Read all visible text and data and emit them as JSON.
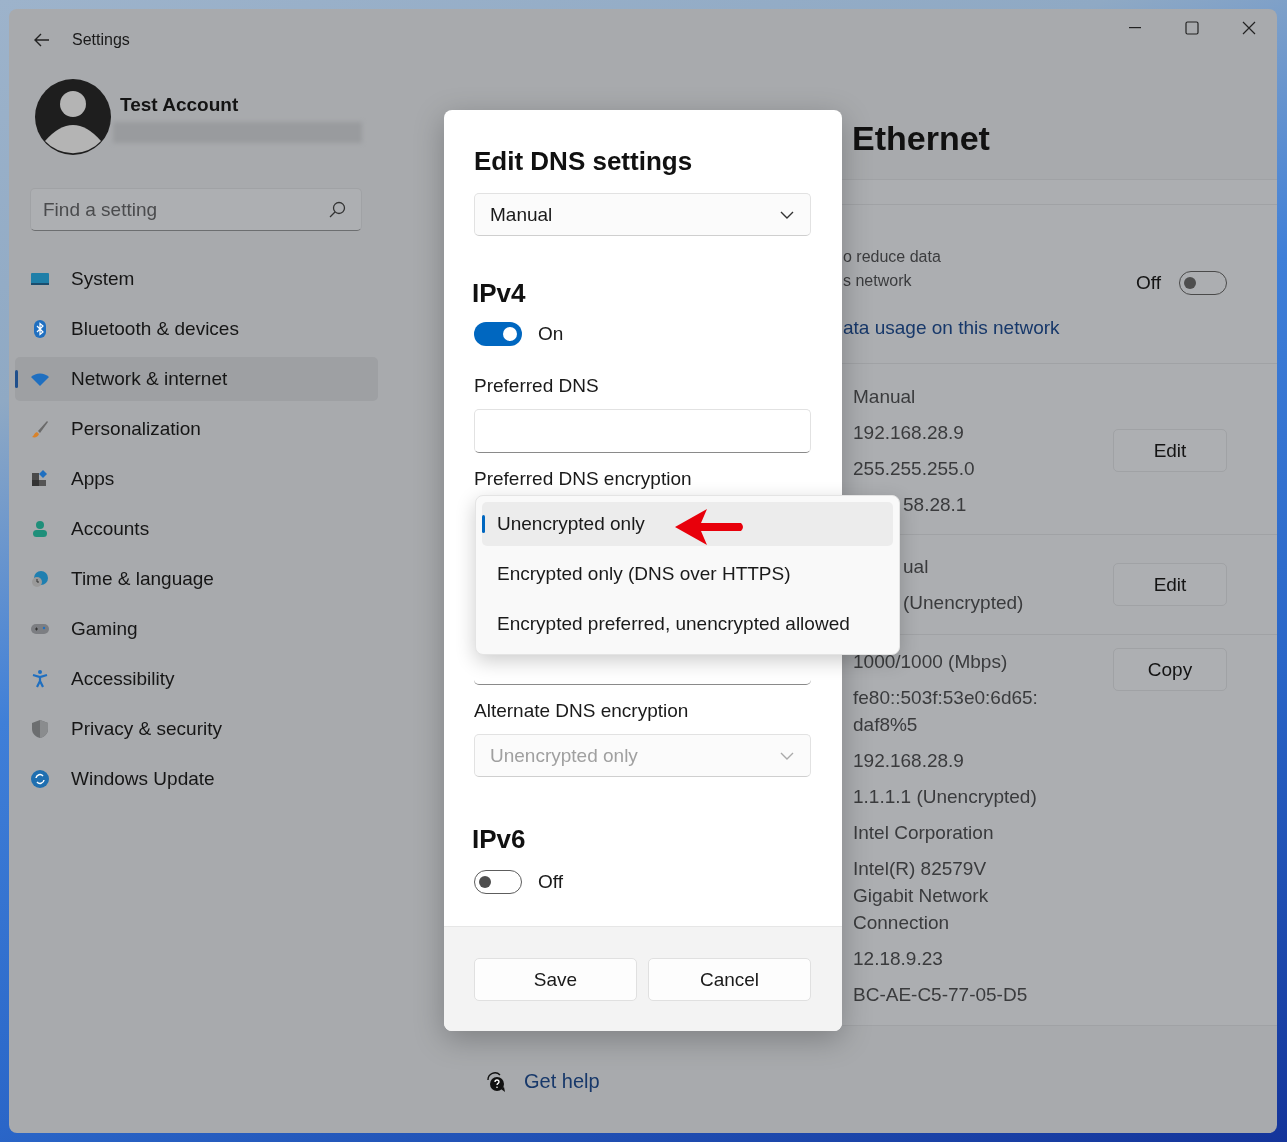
{
  "window": {
    "title": "Settings"
  },
  "account": {
    "name": "Test Account"
  },
  "search": {
    "placeholder": "Find a setting"
  },
  "nav": [
    {
      "label": "System",
      "selected": false
    },
    {
      "label": "Bluetooth & devices",
      "selected": false
    },
    {
      "label": "Network & internet",
      "selected": true
    },
    {
      "label": "Personalization",
      "selected": false
    },
    {
      "label": "Apps",
      "selected": false
    },
    {
      "label": "Accounts",
      "selected": false
    },
    {
      "label": "Time & language",
      "selected": false
    },
    {
      "label": "Gaming",
      "selected": false
    },
    {
      "label": "Accessibility",
      "selected": false
    },
    {
      "label": "Privacy & security",
      "selected": false
    },
    {
      "label": "Windows Update",
      "selected": false
    }
  ],
  "page": {
    "title": "Ethernet",
    "metered": {
      "description": [
        "o reduce data",
        "s network"
      ],
      "state_label": "Off",
      "on": false,
      "link": "ata usage on this network"
    },
    "groups": [
      {
        "button": "Edit",
        "values": [
          {
            "text": "Manual",
            "clipped": false
          },
          {
            "text": "192.168.28.9",
            "clipped": false
          },
          {
            "text": "255.255.255.0",
            "clipped": false
          },
          {
            "text": "58.28.1",
            "clipped": true
          }
        ]
      },
      {
        "button": "Edit",
        "values": [
          {
            "text": "ual",
            "clipped": true
          },
          {
            "text": "(Unencrypted)",
            "clipped": true
          }
        ]
      },
      {
        "button": "Copy",
        "values": [
          {
            "text": "1000/1000 (Mbps)",
            "clipped": false
          },
          {
            "text": "fe80::503f:53e0:6d65:daf8%5",
            "clipped": false
          },
          {
            "text": "192.168.28.9",
            "clipped": false
          },
          {
            "text": "1.1.1.1 (Unencrypted)",
            "clipped": false
          },
          {
            "text": "Intel Corporation",
            "clipped": false
          },
          {
            "text": "Intel(R) 82579V Gigabit Network Connection",
            "clipped": false
          },
          {
            "text": "12.18.9.23",
            "clipped": false
          },
          {
            "text": "BC-AE-C5-77-05-D5",
            "clipped": false
          }
        ]
      }
    ]
  },
  "help_link": "Get help",
  "dialog": {
    "title": "Edit DNS settings",
    "mode": "Manual",
    "ipv4": {
      "heading": "IPv4",
      "on": true,
      "state_label": "On",
      "preferred_dns_label": "Preferred DNS",
      "preferred_encryption_label": "Preferred DNS encryption",
      "encryption_options": [
        {
          "label": "Unencrypted only",
          "selected": true
        },
        {
          "label": "Encrypted only (DNS over HTTPS)",
          "selected": false
        },
        {
          "label": "Encrypted preferred, unencrypted allowed",
          "selected": false
        }
      ],
      "alternate_encryption_label": "Alternate DNS encryption",
      "alternate_encryption": {
        "value": "Unencrypted only",
        "disabled": true
      }
    },
    "ipv6": {
      "heading": "IPv6",
      "on": false,
      "state_label": "Off"
    },
    "buttons": [
      "Save",
      "Cancel"
    ]
  }
}
